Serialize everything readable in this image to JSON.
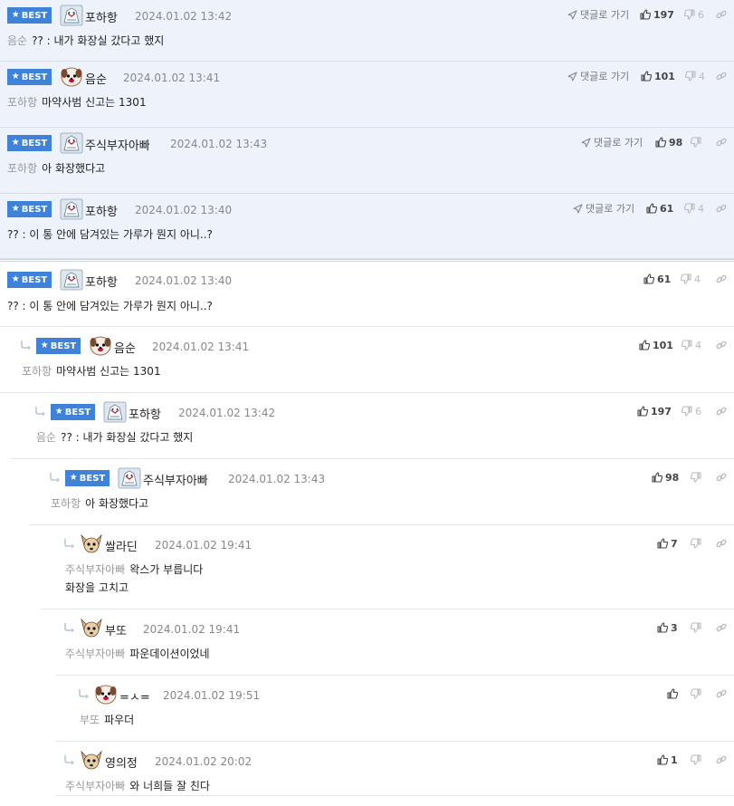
{
  "ui": {
    "best_label": "BEST",
    "goto_label": "댓글로 가기"
  },
  "best_comments": [
    {
      "nick": "포하항",
      "date": "2024.01.02 13:42",
      "mention": "음순",
      "text": "?? : 내가 화장실 갔다고 했지",
      "likes": "197",
      "dislikes": "6",
      "avatar": "mascot"
    },
    {
      "nick": "음순",
      "date": "2024.01.02 13:41",
      "mention": "포하항",
      "text": "마약사범 신고는 1301",
      "likes": "101",
      "dislikes": "4",
      "avatar": "dog"
    },
    {
      "nick": "주식부자아빠",
      "date": "2024.01.02 13:43",
      "mention": "포하항",
      "text": "아 화장했다고",
      "likes": "98",
      "dislikes": "",
      "avatar": "mascot"
    },
    {
      "nick": "포하항",
      "date": "2024.01.02 13:40",
      "mention": "",
      "text": "?? : 이 통 안에 담겨있는 가루가 뭔지 아니..?",
      "likes": "61",
      "dislikes": "4",
      "avatar": "mascot"
    }
  ],
  "thread": [
    {
      "nick": "포하항",
      "date": "2024.01.02 13:40",
      "mention": "",
      "lines": [
        "?? : 이 통 안에 담겨있는 가루가 뭔지 아니..?"
      ],
      "likes": "61",
      "dislikes": "4",
      "best": true,
      "avatar": "mascot"
    },
    {
      "nick": "음순",
      "date": "2024.01.02 13:41",
      "mention": "포하항",
      "lines": [
        "마약사범 신고는 1301"
      ],
      "likes": "101",
      "dislikes": "4",
      "best": true,
      "avatar": "dog"
    },
    {
      "nick": "포하항",
      "date": "2024.01.02 13:42",
      "mention": "음순",
      "lines": [
        "?? : 내가 화장실 갔다고 했지"
      ],
      "likes": "197",
      "dislikes": "6",
      "best": true,
      "avatar": "mascot"
    },
    {
      "nick": "주식부자아빠",
      "date": "2024.01.02 13:43",
      "mention": "포하항",
      "lines": [
        "아 화장했다고"
      ],
      "likes": "98",
      "dislikes": "",
      "best": true,
      "avatar": "mascot"
    },
    {
      "nick": "쌀라딘",
      "date": "2024.01.02 19:41",
      "mention": "주식부자아빠",
      "lines": [
        "왁스가 부릅니다",
        "화장을 고치고"
      ],
      "likes": "7",
      "dislikes": "",
      "best": false,
      "avatar": "chihuahua"
    },
    {
      "nick": "부또",
      "date": "2024.01.02 19:41",
      "mention": "주식부자아빠",
      "lines": [
        "파운데이션이었네"
      ],
      "likes": "3",
      "dislikes": "",
      "best": false,
      "avatar": "chihuahua"
    },
    {
      "nick": "=ㅅ=",
      "date": "2024.01.02 19:51",
      "mention": "부또",
      "lines": [
        "파우더"
      ],
      "likes": "",
      "dislikes": "",
      "best": false,
      "avatar": "dog"
    },
    {
      "nick": "영의정",
      "date": "2024.01.02 20:02",
      "mention": "주식부자아빠",
      "lines": [
        "와 너희들 잘 친다"
      ],
      "likes": "1",
      "dislikes": "",
      "best": false,
      "avatar": "chihuahua"
    }
  ]
}
